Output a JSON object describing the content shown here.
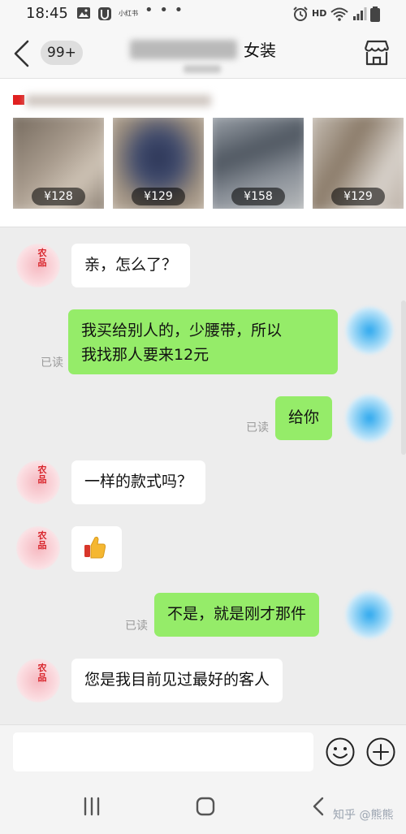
{
  "status_bar": {
    "time": "18:45",
    "small_app_label": "小红书",
    "overflow_dots": "• • •",
    "network_label": "HD",
    "icons": [
      "image-icon",
      "u-app-icon",
      "alarm-icon",
      "wifi-icon",
      "signal-icon",
      "battery-icon"
    ]
  },
  "header": {
    "unread_badge": "99+",
    "title_visible_suffix": "女装",
    "icons": [
      "back-arrow-icon",
      "store-icon"
    ]
  },
  "products": [
    {
      "price": "¥128"
    },
    {
      "price": "¥129"
    },
    {
      "price": "¥158"
    },
    {
      "price": "¥129"
    }
  ],
  "messages": [
    {
      "side": "in",
      "text": "亲，怎么了？"
    },
    {
      "side": "out",
      "lines": [
        "我买给别人的，少腰带，所以",
        "我找那人要来12元"
      ],
      "status": "已读"
    },
    {
      "side": "out",
      "text": "给你",
      "status": "已读"
    },
    {
      "side": "in",
      "text": "一样的款式吗？"
    },
    {
      "side": "in",
      "type": "emoji",
      "emoji_name": "thumbs-up-icon"
    },
    {
      "side": "out",
      "text": "不是，就是刚才那件",
      "status": "已读"
    },
    {
      "side": "in",
      "text": "您是我目前见过最好的客人"
    }
  ],
  "avatar_seal_text": "农品",
  "input_bar": {
    "placeholder": "",
    "icons": [
      "emoji-icon",
      "plus-icon"
    ]
  },
  "nav_bar": {
    "icons": [
      "recent-apps-icon",
      "home-icon",
      "back-icon"
    ],
    "watermark": "知乎 @熊熊"
  },
  "colors": {
    "outgoing_bubble": "#95ec69",
    "incoming_bubble": "#ffffff",
    "background": "#ededed",
    "price_tag_bg": "rgba(0,0,0,0.55)"
  }
}
